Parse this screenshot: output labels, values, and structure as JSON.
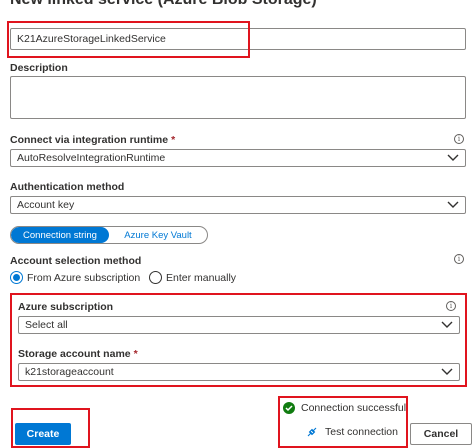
{
  "header": {
    "title": "New linked service (Azure Blob Storage)"
  },
  "form": {
    "name_value": "K21AzureStorageLinkedService",
    "description_label": "Description",
    "description_value": "",
    "runtime_label": "Connect via integration runtime",
    "runtime_required": "*",
    "runtime_value": "AutoResolveIntegrationRuntime",
    "auth_label": "Authentication method",
    "auth_value": "Account key",
    "toggle": {
      "option1": "Connection string",
      "option2": "Azure Key Vault",
      "selected": "Connection string"
    },
    "account_selection_label": "Account selection method",
    "radio": {
      "option1": "From Azure subscription",
      "option2": "Enter manually",
      "selected": "From Azure subscription"
    },
    "subscription_label": "Azure subscription",
    "subscription_value": "Select all",
    "storage_label": "Storage account name",
    "storage_required": "*",
    "storage_value": "k21storageaccount"
  },
  "footer": {
    "create_label": "Create",
    "status_text": "Connection successful",
    "test_label": "Test connection",
    "cancel_label": "Cancel"
  },
  "icons": {
    "info": "info-icon",
    "chevron": "chevron-down-icon",
    "success": "check-circle-icon",
    "plug": "plug-icon"
  },
  "colors": {
    "accent": "#0078d4",
    "highlight": "#e0141e",
    "success": "#107c10"
  }
}
